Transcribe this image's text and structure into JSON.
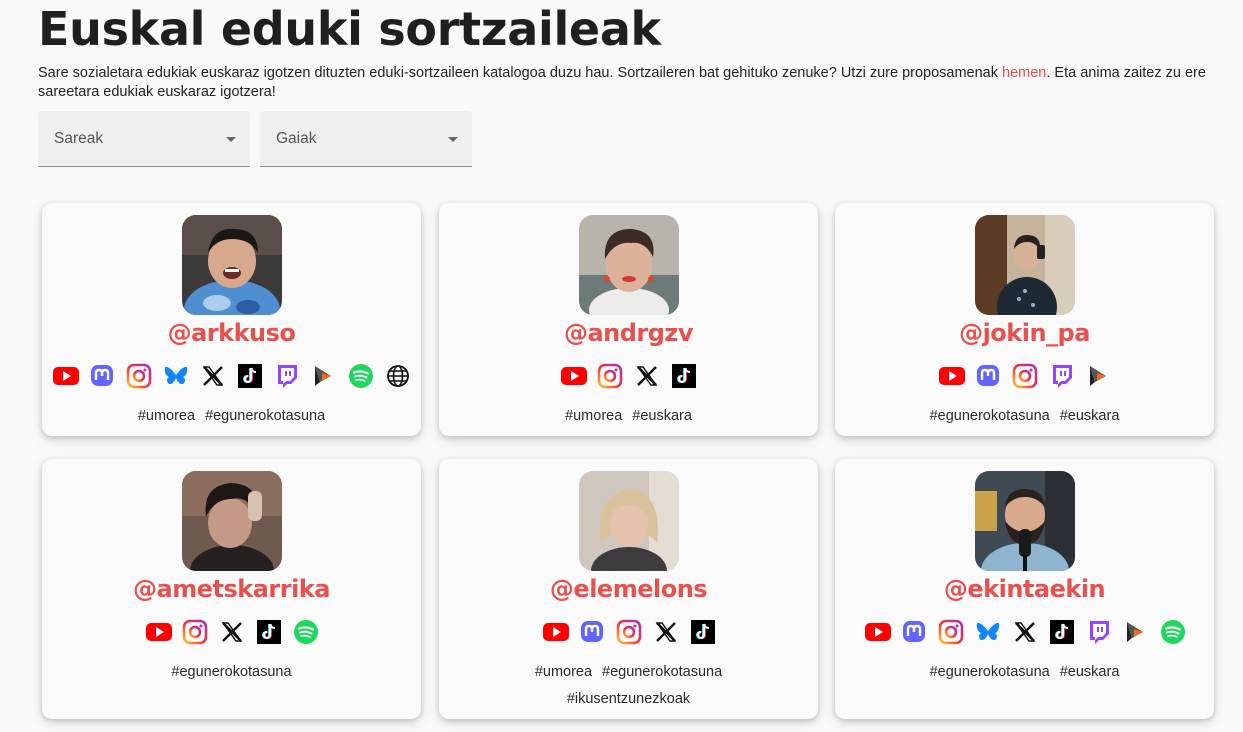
{
  "title": "Euskal eduki sortzaileak",
  "intro": {
    "text_before": "Sare sozialetara edukiak euskaraz igotzen dituzten eduki-sortzaileen katalogoa duzu hau. Sortzaileren bat gehituko zenuke? Utzi zure proposamenak ",
    "link": "hemen",
    "text_after": ". Eta anima zaitez zu ere sareetara edukiak euskaraz igotzera!"
  },
  "filters": {
    "networks_label": "Sareak",
    "topics_label": "Gaiak"
  },
  "colors": {
    "accent": "#e8504e",
    "youtube": "#ff0000",
    "mastodon": "#6364ff",
    "bluesky": "#1185fe",
    "twitch": "#9146ff",
    "spotify": "#1ed760"
  },
  "creators": [
    {
      "handle": "@arkkuso",
      "networks": [
        "youtube",
        "mastodon",
        "instagram",
        "bluesky",
        "x",
        "tiktok",
        "twitch",
        "primeran",
        "spotify",
        "web"
      ],
      "tags": [
        "#umorea",
        "#egunerokotasuna"
      ]
    },
    {
      "handle": "@andrgzv",
      "networks": [
        "youtube",
        "instagram",
        "x",
        "tiktok"
      ],
      "tags": [
        "#umorea",
        "#euskara"
      ]
    },
    {
      "handle": "@jokin_pa",
      "networks": [
        "youtube",
        "mastodon",
        "instagram",
        "twitch",
        "primeran"
      ],
      "tags": [
        "#egunerokotasuna",
        "#euskara"
      ]
    },
    {
      "handle": "@ametskarrika",
      "networks": [
        "youtube",
        "instagram",
        "x",
        "tiktok",
        "spotify"
      ],
      "tags": [
        "#egunerokotasuna"
      ]
    },
    {
      "handle": "@elemelons",
      "networks": [
        "youtube",
        "mastodon",
        "instagram",
        "x",
        "tiktok"
      ],
      "tags": [
        "#umorea",
        "#egunerokotasuna",
        "#ikusentzunezkoak"
      ]
    },
    {
      "handle": "@ekintaekin",
      "networks": [
        "youtube",
        "mastodon",
        "instagram",
        "bluesky",
        "x",
        "tiktok",
        "twitch",
        "primeran",
        "spotify"
      ],
      "tags": [
        "#egunerokotasuna",
        "#euskara"
      ]
    }
  ]
}
